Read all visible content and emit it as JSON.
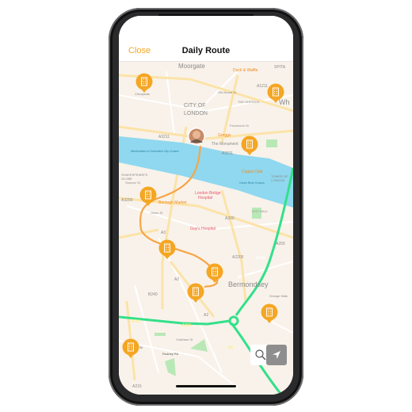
{
  "header": {
    "close_label": "Close",
    "title": "Daily Route"
  },
  "colors": {
    "accent": "#f5a623",
    "route_walk": "#f7a545",
    "route_drive": "#34e08a",
    "water": "#8fd8ef",
    "land": "#f9f2ea",
    "park": "#b9e8b7"
  },
  "map": {
    "labels": [
      "Moorgate",
      "CITY OF",
      "LONDON",
      "Duck & Waffle",
      "A1211",
      "THE GHERKIN",
      "SPITA",
      "Wh",
      "Cheapside",
      "Old Broad St",
      "Fenchurch St",
      "A3211",
      "A3211",
      "Greggs",
      "The Monument",
      "Westminster to Greenwich City Cruises",
      "Green River Cruises",
      "Coppa Club",
      "TOWER OF",
      "LONDON",
      "SHAKESPEARE'S",
      "GLOBE",
      "London Bridge",
      "Hospital",
      "Borough Market",
      "A3200",
      "A200",
      "Union St",
      "CITY HALL",
      "A3",
      "Guy's Hospital",
      "A200",
      "A2205",
      "A100",
      "A2",
      "Bermondsey",
      "B240",
      "A2",
      "A201",
      "A201",
      "A2",
      "Heygate St",
      "Rodney Rd",
      "A215",
      "Sumner St",
      "Chatham St",
      "Grange Walk"
    ],
    "pins": [
      "building-pin",
      "building-pin",
      "building-pin",
      "building-pin",
      "building-pin",
      "building-pin",
      "building-pin",
      "building-pin",
      "building-pin"
    ],
    "user_avatar": "user-avatar"
  },
  "controls": {
    "search_icon": "magnifier-icon",
    "locate_icon": "location-arrow-icon"
  }
}
